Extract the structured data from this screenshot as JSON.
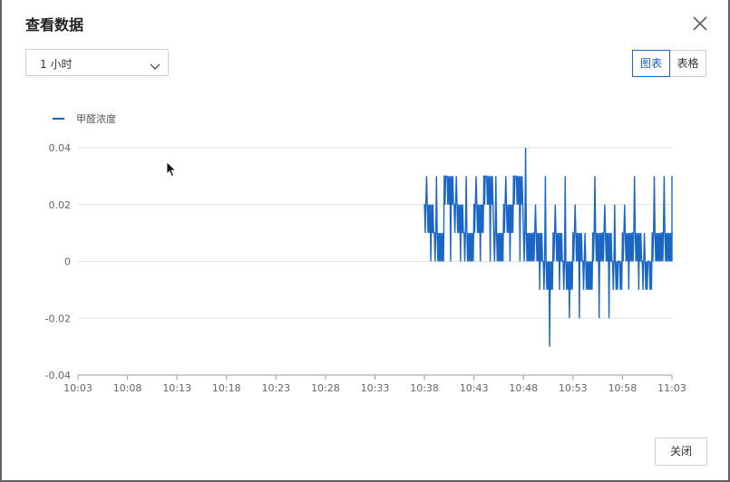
{
  "dialog": {
    "title": "查看数据",
    "range_select": {
      "value": "1 小时"
    },
    "view_toggle": {
      "chart_label": "图表",
      "table_label": "表格",
      "active": "chart"
    },
    "close_button_label": "关闭",
    "icons": {
      "close": "close-icon",
      "dropdown": "chevron-down-icon",
      "cursor": "mouse-cursor-icon"
    }
  },
  "colors": {
    "accent": "#1a66c7",
    "series": "#1a66c7",
    "grid": "#e2e2e2"
  },
  "chart_data": {
    "type": "line",
    "series": [
      {
        "name": "甲醛浓度",
        "color": "#1a66c7",
        "x": [
          "10:38",
          "10:39",
          "10:40",
          "10:41",
          "10:42",
          "10:43",
          "10:44",
          "10:45",
          "10:46",
          "10:47",
          "10:48",
          "10:49",
          "10:50",
          "10:51",
          "10:52",
          "10:53",
          "10:54",
          "10:55",
          "10:56",
          "10:57",
          "10:58",
          "10:59",
          "11:00",
          "11:01",
          "11:02",
          "11:03"
        ],
        "y": [
          0.02,
          0.01,
          0.03,
          0.02,
          0.01,
          0.02,
          0.03,
          0.01,
          0.02,
          0.03,
          0.01,
          0.01,
          0.0,
          0.01,
          0.0,
          0.01,
          0.0,
          0.01,
          0.01,
          0.0,
          0.01,
          0.01,
          0.0,
          0.01,
          0.01,
          0.01
        ],
        "y_min": [
          0.0,
          0.0,
          0.0,
          0.0,
          0.0,
          0.0,
          0.0,
          0.0,
          0.0,
          0.0,
          0.0,
          -0.01,
          -0.03,
          -0.01,
          -0.02,
          -0.02,
          -0.01,
          -0.02,
          -0.02,
          0.0,
          -0.01,
          -0.01,
          0.0,
          0.0,
          0.0,
          0.0
        ],
        "y_max": [
          0.03,
          0.03,
          0.03,
          0.03,
          0.03,
          0.03,
          0.03,
          0.03,
          0.03,
          0.03,
          0.04,
          0.02,
          0.03,
          0.02,
          0.03,
          0.02,
          0.01,
          0.03,
          0.02,
          0.02,
          0.02,
          0.03,
          0.01,
          0.03,
          0.03,
          0.03
        ]
      }
    ],
    "x_ticks": [
      "10:03",
      "10:08",
      "10:13",
      "10:18",
      "10:23",
      "10:28",
      "10:33",
      "10:38",
      "10:43",
      "10:48",
      "10:53",
      "10:58",
      "11:03"
    ],
    "y_ticks": [
      "0.04",
      "0.02",
      "0",
      "-0.02",
      "-0.04"
    ],
    "ylim": [
      -0.04,
      0.04
    ],
    "xlim": [
      "10:03",
      "11:03"
    ],
    "grid": true,
    "legend": "top-left"
  }
}
